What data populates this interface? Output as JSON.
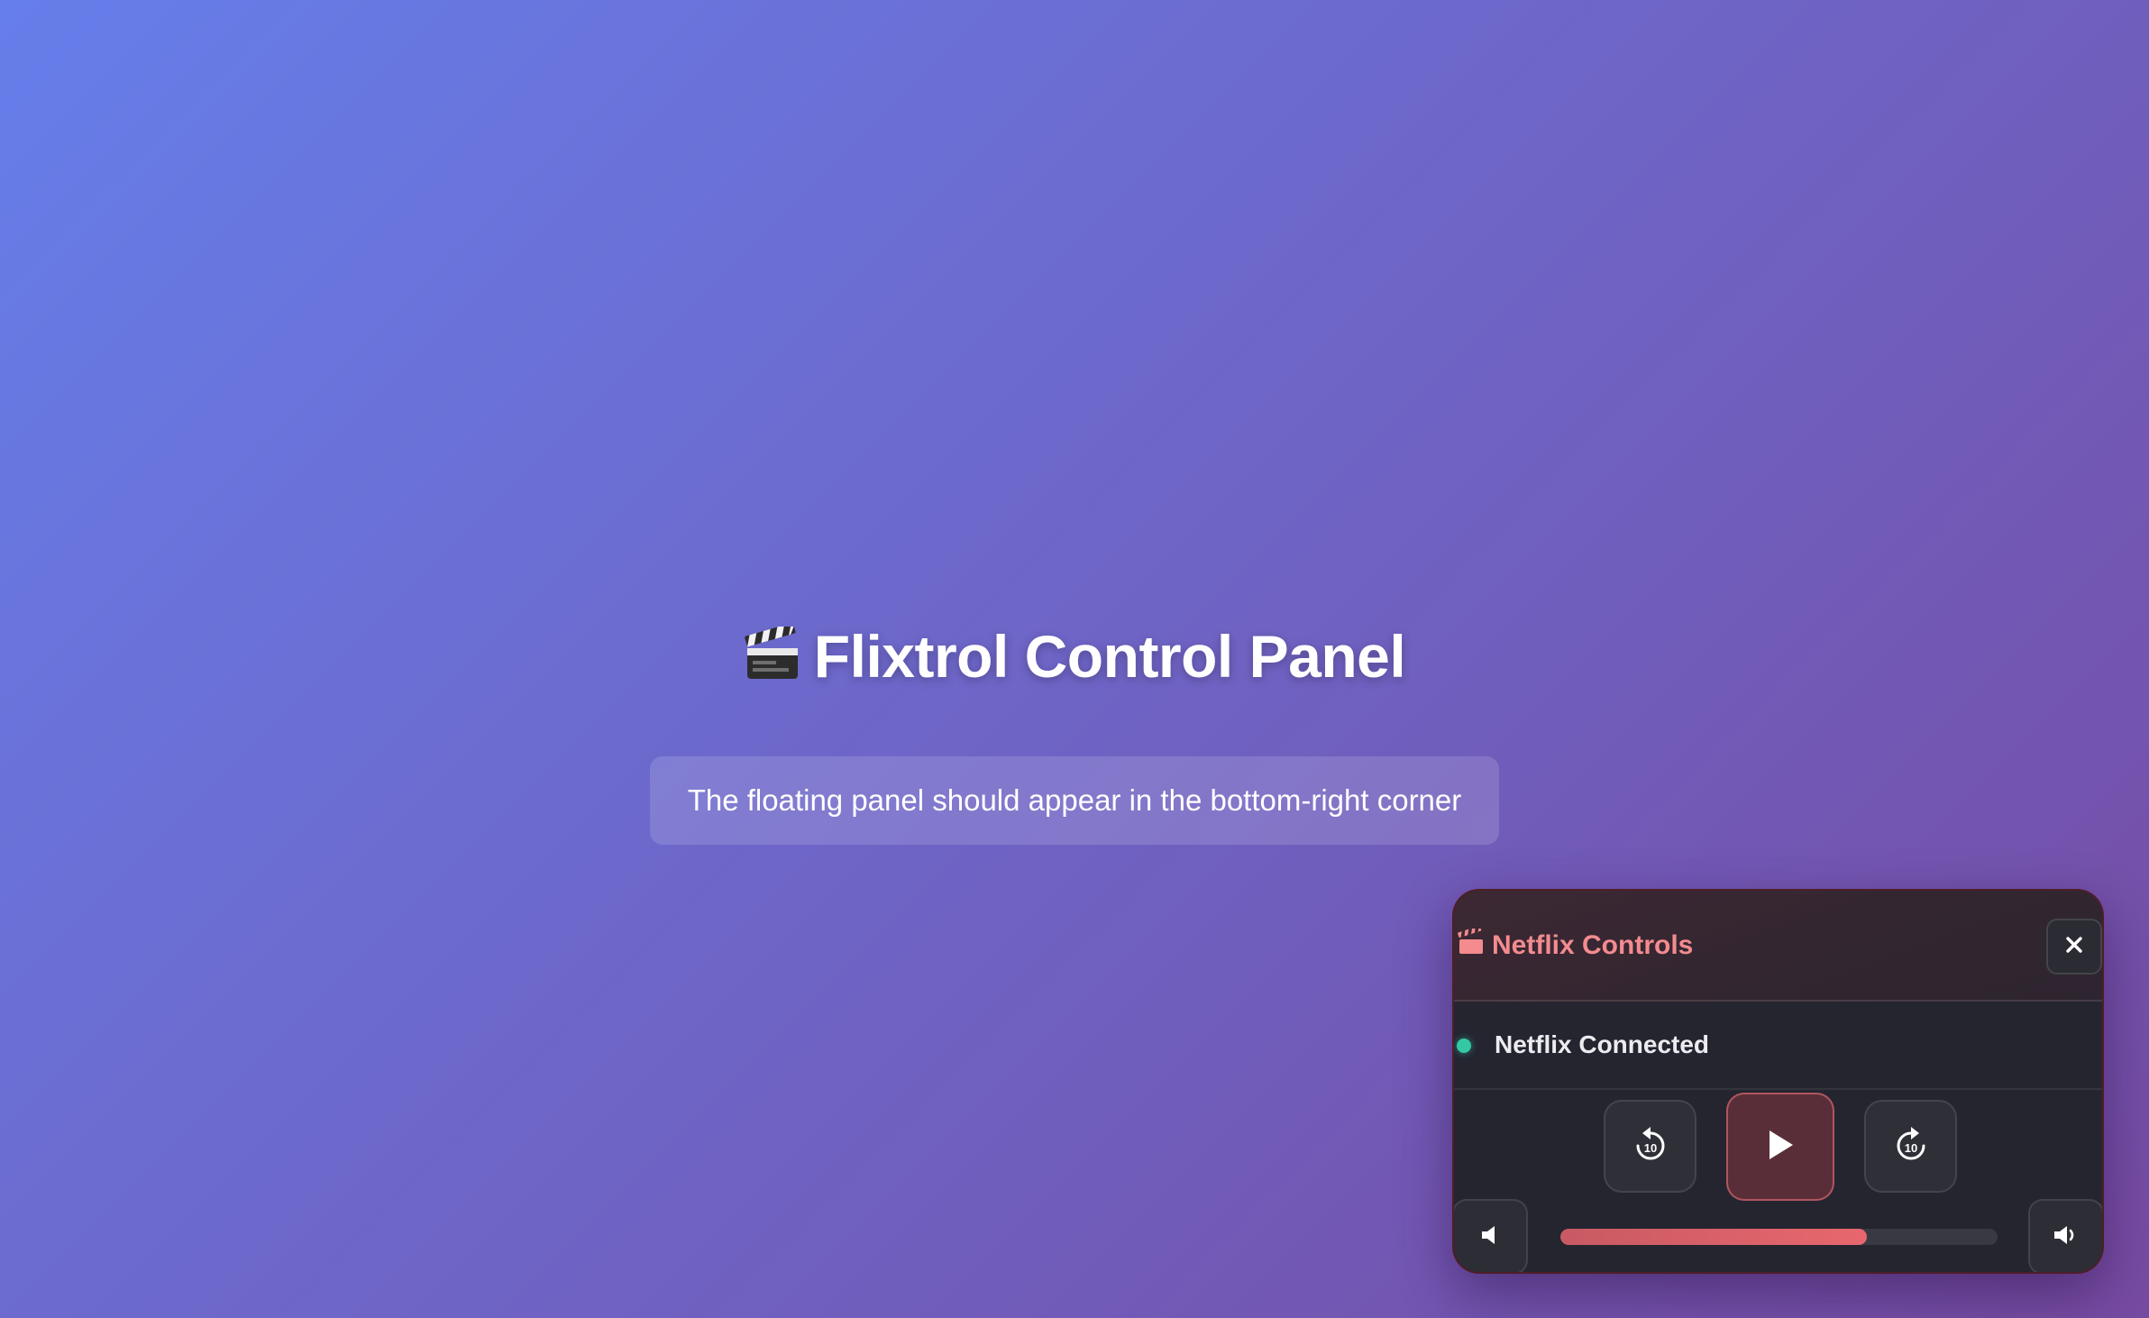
{
  "page": {
    "title": "Flixtrol Control Panel",
    "title_icon": "clapperboard-icon",
    "hint": "The floating panel should appear in the bottom-right corner"
  },
  "panel": {
    "title": "Netflix Controls",
    "title_icon": "clapperboard-icon",
    "close_label": "✕",
    "status": {
      "text": "Netflix Connected",
      "color": "#34c9a5"
    },
    "controls": {
      "rewind_icon": "rewind-10-icon",
      "rewind_seconds": "10",
      "play_icon": "play-icon",
      "forward_icon": "forward-10-icon",
      "forward_seconds": "10"
    },
    "volume": {
      "down_icon": "volume-down-icon",
      "up_icon": "volume-up-icon",
      "level": 0.7
    },
    "accent_color": "#f38b8f"
  }
}
